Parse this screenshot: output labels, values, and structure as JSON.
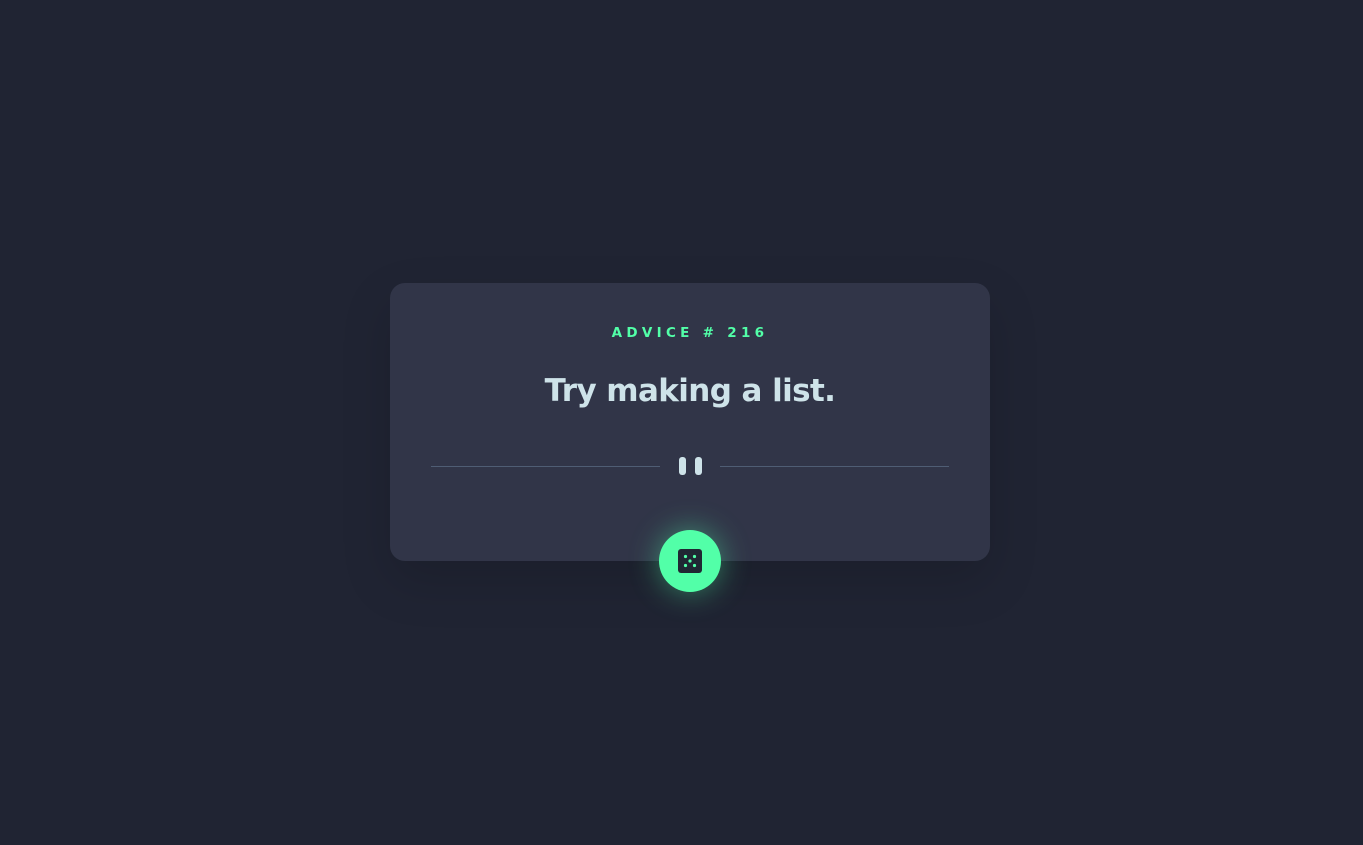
{
  "advice": {
    "id_label": "ADVICE # 216",
    "text": "Try making a list."
  },
  "dice_button": {
    "icon": "dice-icon"
  },
  "divider": {
    "icon": "pause-icon"
  },
  "colors": {
    "background": "#202433",
    "card": "#313548",
    "accent": "#52ffa8",
    "text": "#cee3e9",
    "divider_line": "#4f5d74"
  }
}
